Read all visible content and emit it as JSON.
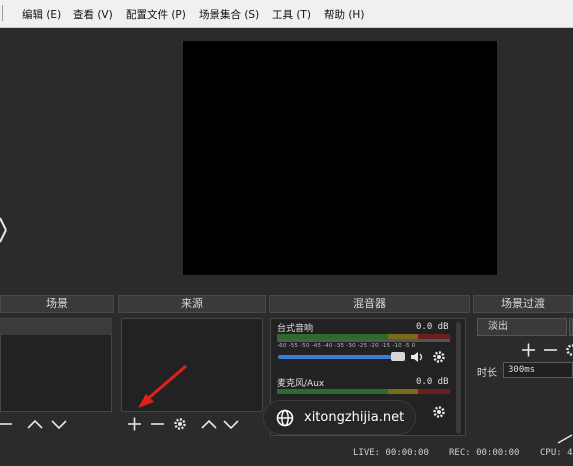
{
  "menu": {
    "items": [
      "编辑 (E)",
      "查看 (V)",
      "配置文件 (P)",
      "场景集合 (S)",
      "工具 (T)",
      "帮助 (H)"
    ]
  },
  "docks": {
    "scenes": "场景",
    "sources": "来源",
    "mixer": "混音器",
    "transitions": "场景过渡"
  },
  "mixer": {
    "channels": [
      {
        "name": "台式音响",
        "db": "0.0 dB"
      },
      {
        "name": "麦克风/Aux",
        "db": "0.0 dB"
      }
    ],
    "scale": "-60 -55 -50 -45 -40 -35 -30 -25 -20 -15 -10 -5 0"
  },
  "transitions": {
    "type": "淡出",
    "duration_label": "时长",
    "duration_value": "300ms"
  },
  "status": {
    "live": "LIVE: 00:00:00",
    "rec": "REC: 00:00:00",
    "cpu": "CPU: 4"
  },
  "watermark": {
    "text": "xitongzhijia.net"
  },
  "colors": {
    "accent": "#3d7bd8",
    "arrow": "#e0201c",
    "meter_green": "#4caf50",
    "meter_yellow": "#c9b030",
    "meter_red": "#c03030"
  },
  "icons": [
    "add-icon",
    "remove-icon",
    "gear-icon",
    "up-icon",
    "down-icon",
    "speaker-icon",
    "globe-icon"
  ]
}
